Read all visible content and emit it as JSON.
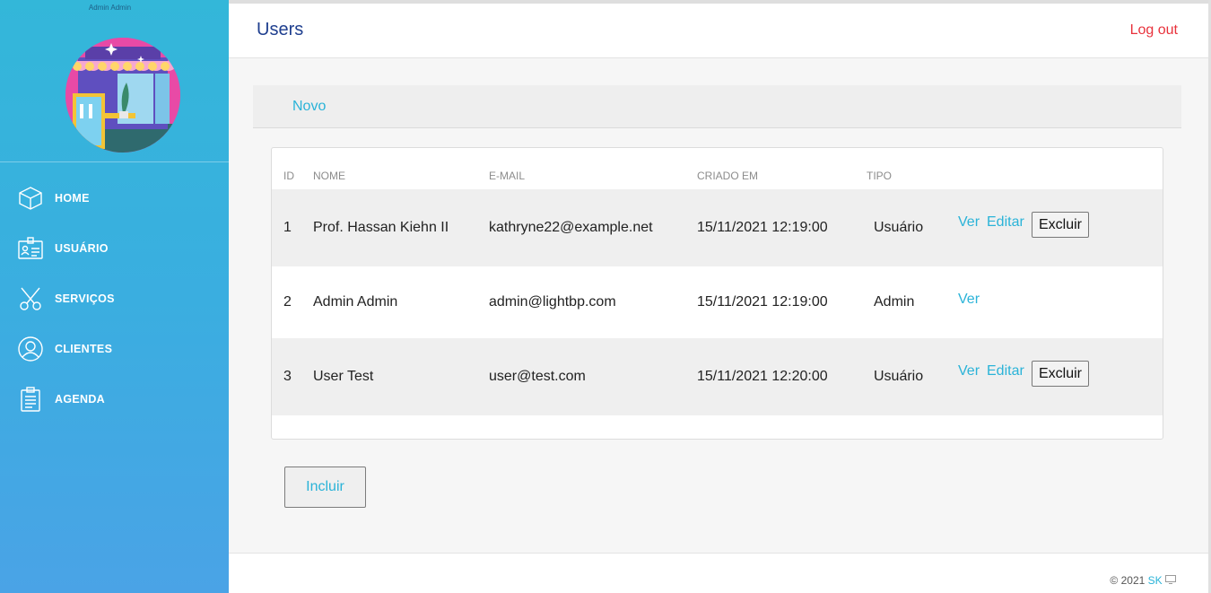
{
  "sidebar": {
    "user_name": "Admin Admin",
    "items": [
      {
        "label": "HOME",
        "icon": "cube-icon"
      },
      {
        "label": "USUÁRIO",
        "icon": "id-card-icon"
      },
      {
        "label": "SERVIÇOS",
        "icon": "scissors-icon"
      },
      {
        "label": "CLIENTES",
        "icon": "user-circle-icon"
      },
      {
        "label": "AGENDA",
        "icon": "clipboard-icon"
      }
    ]
  },
  "header": {
    "title": "Users",
    "logout_label": "Log out"
  },
  "toolbar": {
    "novo_label": "Novo"
  },
  "table": {
    "columns": [
      "ID",
      "NOME",
      "E-MAIL",
      "CRIADO EM",
      "TIPO"
    ],
    "rows": [
      {
        "id": "1",
        "name": "Prof. Hassan Kiehn II",
        "email": "kathryne22@example.net",
        "created": "15/11/2021 12:19:00",
        "type": "Usuário",
        "ver": "Ver",
        "editar": "Editar",
        "excluir": "Excluir"
      },
      {
        "id": "2",
        "name": "Admin Admin",
        "email": "admin@lightbp.com",
        "created": "15/11/2021 12:19:00",
        "type": "Admin",
        "ver": "Ver"
      },
      {
        "id": "3",
        "name": "User Test",
        "email": "user@test.com",
        "created": "15/11/2021 12:20:00",
        "type": "Usuário",
        "ver": "Ver",
        "editar": "Editar",
        "excluir": "Excluir"
      }
    ]
  },
  "incluir_label": "Incluir",
  "footer": {
    "copyright": "© 2021",
    "brand": "SK"
  },
  "colors": {
    "accent": "#2ab3d8",
    "logout": "#e8323c",
    "title": "#1f3f8f"
  }
}
